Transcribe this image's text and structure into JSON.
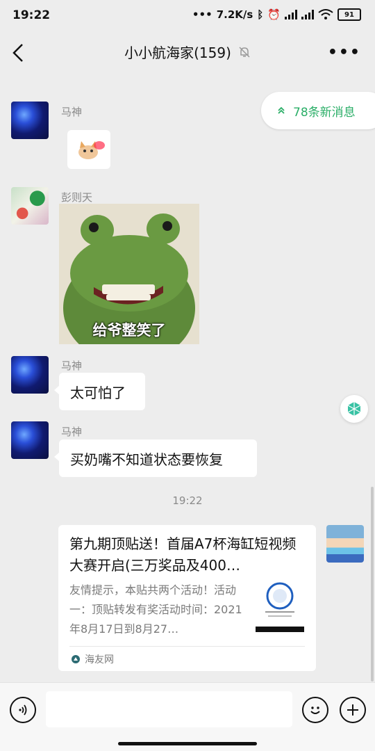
{
  "status_bar": {
    "time": "19:22",
    "network_speed": "7.2K/s",
    "battery": "91"
  },
  "header": {
    "title": "小小航海家(159)"
  },
  "new_messages": {
    "label": "78条新消息"
  },
  "messages": [
    {
      "sender": "马神",
      "type": "sticker"
    },
    {
      "sender": "彭则天",
      "type": "image",
      "caption": "给爷整笑了"
    },
    {
      "sender": "马神",
      "type": "text",
      "text": "太可怕了"
    },
    {
      "sender": "马神",
      "type": "text",
      "text": "买奶嘴不知道状态要恢复"
    }
  ],
  "timestamp": "19:22",
  "link_card": {
    "title": "第九期顶贴送！首届A7杯海缸短视频大赛开启(三万奖品及400…",
    "description": "友情提示，本贴共两个活动！活动一：顶贴转发有奖活动时间：2021年8月17日到8月27…",
    "source": "海友网"
  }
}
